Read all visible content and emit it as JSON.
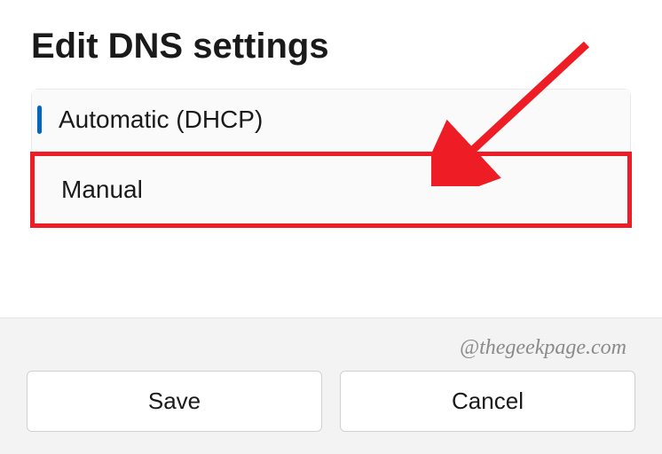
{
  "dialog": {
    "title": "Edit DNS settings",
    "options": {
      "automatic": "Automatic (DHCP)",
      "manual": "Manual"
    },
    "buttons": {
      "save": "Save",
      "cancel": "Cancel"
    }
  },
  "watermark": "@thegeekpage.com",
  "annotation": {
    "highlight_color": "#ee1c25",
    "arrow_target": "manual-option"
  }
}
